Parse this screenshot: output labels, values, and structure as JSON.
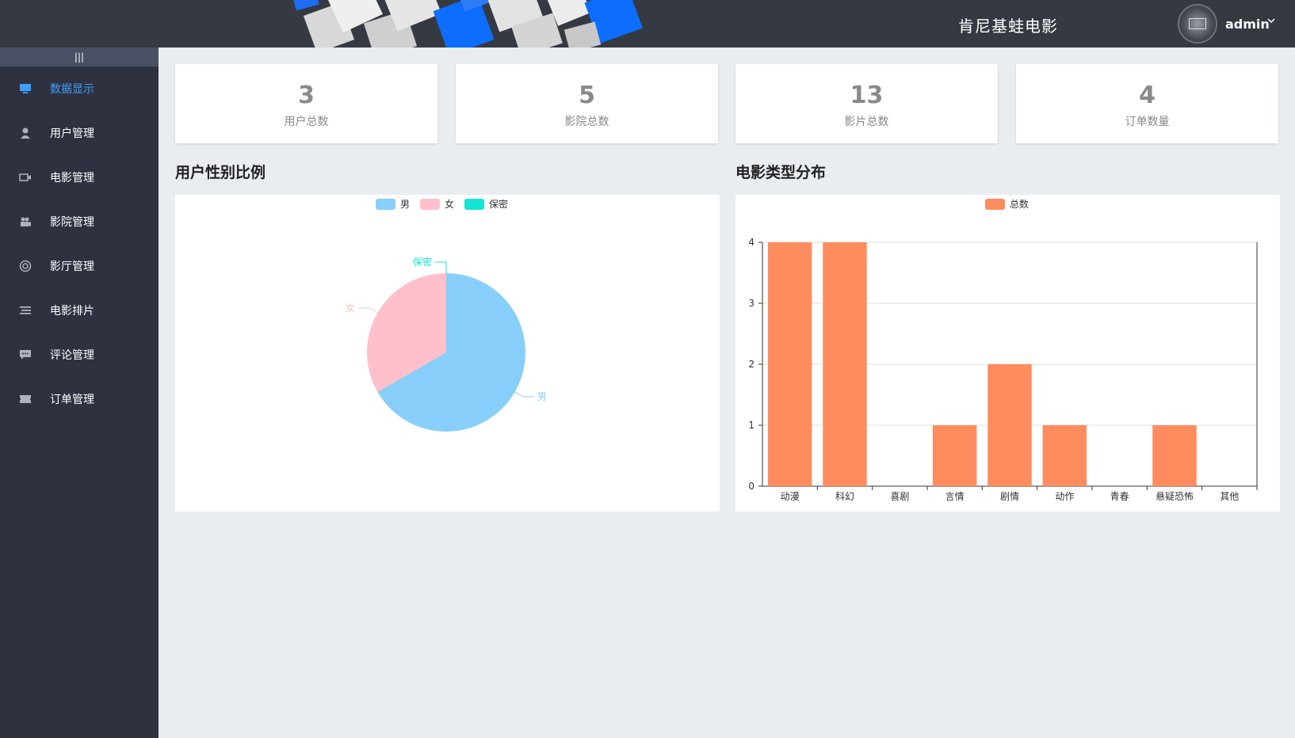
{
  "header": {
    "site_title": "肯尼基蛙电影",
    "username": "admin",
    "dropdown_icon": "chevron-down-icon"
  },
  "sidebar": {
    "collapse_label": "|||",
    "items": [
      {
        "label": "数据显示",
        "icon": "monitor-icon",
        "active": true
      },
      {
        "label": "用户管理",
        "icon": "user-icon",
        "active": false
      },
      {
        "label": "电影管理",
        "icon": "video-camera-icon",
        "active": false
      },
      {
        "label": "影院管理",
        "icon": "projector-icon",
        "active": false
      },
      {
        "label": "影厅管理",
        "icon": "ring-icon",
        "active": false
      },
      {
        "label": "电影排片",
        "icon": "list-icon",
        "active": false
      },
      {
        "label": "评论管理",
        "icon": "comment-icon",
        "active": false
      },
      {
        "label": "订单管理",
        "icon": "ticket-icon",
        "active": false
      }
    ]
  },
  "stats": [
    {
      "value": "3",
      "label": "用户总数"
    },
    {
      "value": "5",
      "label": "影院总数"
    },
    {
      "value": "13",
      "label": "影片总数"
    },
    {
      "value": "4",
      "label": "订单数量"
    }
  ],
  "sections": {
    "gender_title": "用户性别比例",
    "genre_title": "电影类型分布"
  },
  "colors": {
    "male": "#87cefa",
    "female": "#ffc0cb",
    "secret": "#17e5d3",
    "bar": "#ff8c5e",
    "active": "#409eff"
  },
  "chart_data": [
    {
      "type": "pie",
      "title": "",
      "legend": [
        "男",
        "女",
        "保密"
      ],
      "legend_position": "top",
      "slices": [
        {
          "name": "男",
          "value": 2
        },
        {
          "name": "女",
          "value": 1
        },
        {
          "name": "保密",
          "value": 0
        }
      ]
    },
    {
      "type": "bar",
      "title": "",
      "legend": [
        "总数"
      ],
      "legend_position": "top",
      "categories": [
        "动漫",
        "科幻",
        "喜剧",
        "言情",
        "剧情",
        "动作",
        "青春",
        "悬疑恐怖",
        "其他"
      ],
      "series": [
        {
          "name": "总数",
          "values": [
            4,
            4,
            0,
            1,
            2,
            1,
            0,
            1,
            0
          ]
        }
      ],
      "yticks": [
        "0",
        "1",
        "2",
        "3",
        "4"
      ],
      "ylim": [
        0,
        4
      ],
      "grid": true
    }
  ]
}
